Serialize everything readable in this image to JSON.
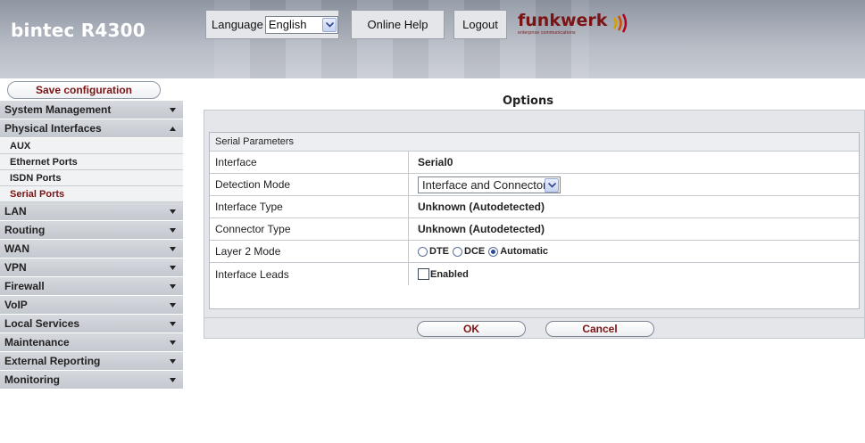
{
  "header": {
    "product": "bintec R4300",
    "language_label": "Language",
    "language_value": "English",
    "help_label": "Online Help",
    "logout_label": "Logout",
    "logo_text": "funkwerk",
    "logo_subtext": "enterprise communications"
  },
  "sidebar": {
    "save_label": "Save configuration",
    "items": [
      {
        "label": "System Management",
        "expanded": false
      },
      {
        "label": "Physical Interfaces",
        "expanded": true,
        "children": [
          "AUX",
          "Ethernet Ports",
          "ISDN Ports",
          "Serial Ports"
        ],
        "active_child": "Serial Ports"
      },
      {
        "label": "LAN",
        "expanded": false
      },
      {
        "label": "Routing",
        "expanded": false
      },
      {
        "label": "WAN",
        "expanded": false
      },
      {
        "label": "VPN",
        "expanded": false
      },
      {
        "label": "Firewall",
        "expanded": false
      },
      {
        "label": "VoIP",
        "expanded": false
      },
      {
        "label": "Local Services",
        "expanded": false
      },
      {
        "label": "Maintenance",
        "expanded": false
      },
      {
        "label": "External Reporting",
        "expanded": false
      },
      {
        "label": "Monitoring",
        "expanded": false
      }
    ]
  },
  "main": {
    "tab_title": "Options",
    "section_title": "Serial Parameters",
    "rows": {
      "interface": {
        "label": "Interface",
        "value": "Serial0"
      },
      "detection_mode": {
        "label": "Detection Mode",
        "value": "Interface and Connector"
      },
      "interface_type": {
        "label": "Interface Type",
        "value": "Unknown (Autodetected)"
      },
      "connector_type": {
        "label": "Connector Type",
        "value": "Unknown (Autodetected)"
      },
      "layer2_mode": {
        "label": "Layer 2 Mode",
        "options": [
          "DTE",
          "DCE",
          "Automatic"
        ],
        "selected": "Automatic"
      },
      "interface_leads": {
        "label": "Interface Leads",
        "checkbox_label": "Enabled",
        "checked": false
      }
    },
    "ok_label": "OK",
    "cancel_label": "Cancel"
  },
  "colors": {
    "accent": "#7a1414",
    "menu_bg": "#c9cdd4",
    "panel_bg": "#e4e6ea"
  }
}
